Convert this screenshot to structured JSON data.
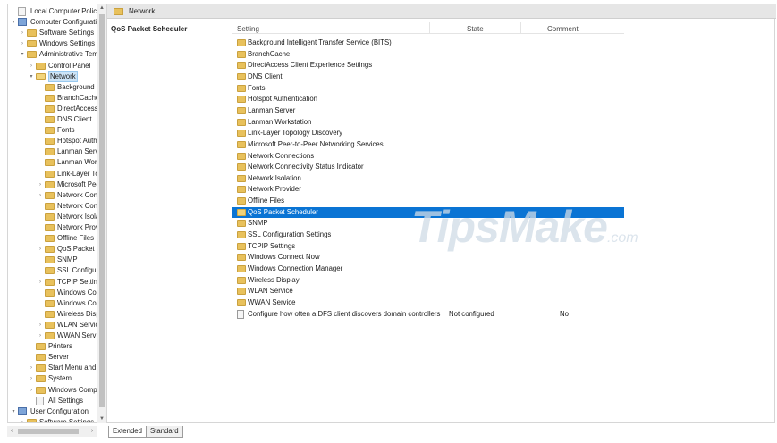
{
  "tree": {
    "nodes": [
      {
        "label": "Local Computer Policy",
        "icon": "document-icon",
        "level": 0,
        "expander": ""
      },
      {
        "label": "Computer Configuration",
        "icon": "computer-icon",
        "level": 0,
        "expander": "▾"
      },
      {
        "label": "Software Settings",
        "icon": "folder-icon",
        "level": 1,
        "expander": "›"
      },
      {
        "label": "Windows Settings",
        "icon": "folder-icon",
        "level": 1,
        "expander": "›"
      },
      {
        "label": "Administrative Templates",
        "icon": "folder-icon",
        "level": 1,
        "expander": "▾"
      },
      {
        "label": "Control Panel",
        "icon": "folder-icon",
        "level": 2,
        "expander": "›"
      },
      {
        "label": "Network",
        "icon": "folder-open-icon",
        "level": 2,
        "expander": "▾",
        "selected": true
      },
      {
        "label": "Background Intelligent Transfer Service (BITS)",
        "icon": "folder-icon",
        "level": 3,
        "expander": ""
      },
      {
        "label": "BranchCache",
        "icon": "folder-icon",
        "level": 3,
        "expander": ""
      },
      {
        "label": "DirectAccess Client Experience Settings",
        "icon": "folder-icon",
        "level": 3,
        "expander": ""
      },
      {
        "label": "DNS Client",
        "icon": "folder-icon",
        "level": 3,
        "expander": ""
      },
      {
        "label": "Fonts",
        "icon": "folder-icon",
        "level": 3,
        "expander": ""
      },
      {
        "label": "Hotspot Authentication",
        "icon": "folder-icon",
        "level": 3,
        "expander": ""
      },
      {
        "label": "Lanman Server",
        "icon": "folder-icon",
        "level": 3,
        "expander": ""
      },
      {
        "label": "Lanman Workstation",
        "icon": "folder-icon",
        "level": 3,
        "expander": ""
      },
      {
        "label": "Link-Layer Topology Discovery",
        "icon": "folder-icon",
        "level": 3,
        "expander": ""
      },
      {
        "label": "Microsoft Peer-to-Peer Networking Services",
        "icon": "folder-icon",
        "level": 3,
        "expander": "›"
      },
      {
        "label": "Network Connections",
        "icon": "folder-icon",
        "level": 3,
        "expander": "›"
      },
      {
        "label": "Network Connectivity Status Indicator",
        "icon": "folder-icon",
        "level": 3,
        "expander": ""
      },
      {
        "label": "Network Isolation",
        "icon": "folder-icon",
        "level": 3,
        "expander": ""
      },
      {
        "label": "Network Provider",
        "icon": "folder-icon",
        "level": 3,
        "expander": ""
      },
      {
        "label": "Offline Files",
        "icon": "folder-icon",
        "level": 3,
        "expander": ""
      },
      {
        "label": "QoS Packet Scheduler",
        "icon": "folder-icon",
        "level": 3,
        "expander": "›"
      },
      {
        "label": "SNMP",
        "icon": "folder-icon",
        "level": 3,
        "expander": ""
      },
      {
        "label": "SSL Configuration Settings",
        "icon": "folder-icon",
        "level": 3,
        "expander": ""
      },
      {
        "label": "TCPIP Settings",
        "icon": "folder-icon",
        "level": 3,
        "expander": "›"
      },
      {
        "label": "Windows Connect Now",
        "icon": "folder-icon",
        "level": 3,
        "expander": ""
      },
      {
        "label": "Windows Connection Manager",
        "icon": "folder-icon",
        "level": 3,
        "expander": ""
      },
      {
        "label": "Wireless Display",
        "icon": "folder-icon",
        "level": 3,
        "expander": ""
      },
      {
        "label": "WLAN Service",
        "icon": "folder-icon",
        "level": 3,
        "expander": "›"
      },
      {
        "label": "WWAN Service",
        "icon": "folder-icon",
        "level": 3,
        "expander": "›"
      },
      {
        "label": "Printers",
        "icon": "folder-icon",
        "level": 2,
        "expander": ""
      },
      {
        "label": "Server",
        "icon": "folder-icon",
        "level": 2,
        "expander": ""
      },
      {
        "label": "Start Menu and Taskbar",
        "icon": "folder-icon",
        "level": 2,
        "expander": "›"
      },
      {
        "label": "System",
        "icon": "folder-icon",
        "level": 2,
        "expander": "›"
      },
      {
        "label": "Windows Components",
        "icon": "folder-icon",
        "level": 2,
        "expander": "›"
      },
      {
        "label": "All Settings",
        "icon": "settings-page-icon",
        "level": 2,
        "expander": ""
      },
      {
        "label": "User Configuration",
        "icon": "user-icon",
        "level": 0,
        "expander": "▾"
      },
      {
        "label": "Software Settings",
        "icon": "folder-icon",
        "level": 1,
        "expander": "›"
      }
    ]
  },
  "right": {
    "header_title": "Network",
    "extended_title": "QoS Packet Scheduler",
    "columns": {
      "setting": "Setting",
      "state": "State",
      "comment": "Comment"
    },
    "rows": [
      {
        "name": "Background Intelligent Transfer Service (BITS)",
        "type": "folder"
      },
      {
        "name": "BranchCache",
        "type": "folder"
      },
      {
        "name": "DirectAccess Client Experience Settings",
        "type": "folder"
      },
      {
        "name": "DNS Client",
        "type": "folder"
      },
      {
        "name": "Fonts",
        "type": "folder"
      },
      {
        "name": "Hotspot Authentication",
        "type": "folder"
      },
      {
        "name": "Lanman Server",
        "type": "folder"
      },
      {
        "name": "Lanman Workstation",
        "type": "folder"
      },
      {
        "name": "Link-Layer Topology Discovery",
        "type": "folder"
      },
      {
        "name": "Microsoft Peer-to-Peer Networking Services",
        "type": "folder"
      },
      {
        "name": "Network Connections",
        "type": "folder"
      },
      {
        "name": "Network Connectivity Status Indicator",
        "type": "folder"
      },
      {
        "name": "Network Isolation",
        "type": "folder"
      },
      {
        "name": "Network Provider",
        "type": "folder"
      },
      {
        "name": "Offline Files",
        "type": "folder"
      },
      {
        "name": "QoS Packet Scheduler",
        "type": "folder",
        "selected": true
      },
      {
        "name": "SNMP",
        "type": "folder"
      },
      {
        "name": "SSL Configuration Settings",
        "type": "folder"
      },
      {
        "name": "TCPIP Settings",
        "type": "folder"
      },
      {
        "name": "Windows Connect Now",
        "type": "folder"
      },
      {
        "name": "Windows Connection Manager",
        "type": "folder"
      },
      {
        "name": "Wireless Display",
        "type": "folder"
      },
      {
        "name": "WLAN Service",
        "type": "folder"
      },
      {
        "name": "WWAN Service",
        "type": "folder"
      },
      {
        "name": "Configure how often a DFS client discovers domain controllers",
        "type": "policy",
        "state": "Not configured",
        "comment": "No"
      }
    ]
  },
  "tabs": {
    "extended": "Extended",
    "standard": "Standard"
  },
  "watermark": {
    "text": "TipsMake",
    "suffix": ".com"
  },
  "colors": {
    "selection": "#0a74d4",
    "folder": "#e8c15c",
    "tree_selection": "#cce4f7"
  }
}
